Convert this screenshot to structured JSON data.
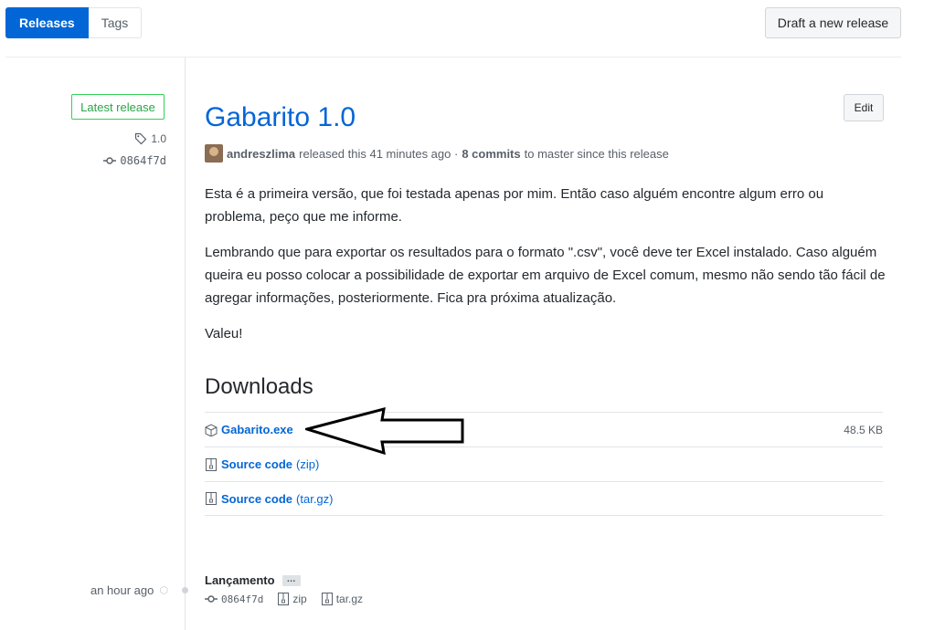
{
  "tabs": {
    "releases": "Releases",
    "tags": "Tags"
  },
  "draft_button": "Draft a new release",
  "sidebar": {
    "latest_badge": "Latest release",
    "tag": "1.0",
    "commit": "0864f7d"
  },
  "release": {
    "title": "Gabarito 1.0",
    "edit": "Edit",
    "author": "andreszlima",
    "released_text": "released this 41 minutes ago ·",
    "commits": "8 commits",
    "commits_suffix": "to master since this release",
    "paragraphs": [
      "Esta é a primeira versão, que foi testada apenas por mim. Então caso alguém encontre algum erro ou problema, peço que me informe.",
      "Lembrando que para exportar os resultados para o formato \".csv\", você deve ter Excel instalado. Caso alguém queira eu posso colocar a possibilidade de exportar em arquivo de Excel comum, mesmo não sendo tão fácil de agregar informações, posteriormente. Fica pra próxima atualização.",
      "Valeu!"
    ],
    "downloads_heading": "Downloads",
    "downloads": [
      {
        "name": "Gabarito.exe",
        "suffix": "",
        "size": "48.5 KB",
        "icon": "package-icon"
      },
      {
        "name": "Source code",
        "suffix": "(zip)",
        "size": "",
        "icon": "file-zip-icon"
      },
      {
        "name": "Source code",
        "suffix": "(tar.gz)",
        "size": "",
        "icon": "file-zip-icon"
      }
    ]
  },
  "older_release": {
    "time": "an hour ago",
    "title": "Lançamento",
    "ellipsis": "…",
    "commit": "0864f7d",
    "zip": "zip",
    "targz": "tar.gz"
  },
  "colors": {
    "accent": "#0366d6",
    "latest_green": "#28a745",
    "muted": "#586069"
  }
}
